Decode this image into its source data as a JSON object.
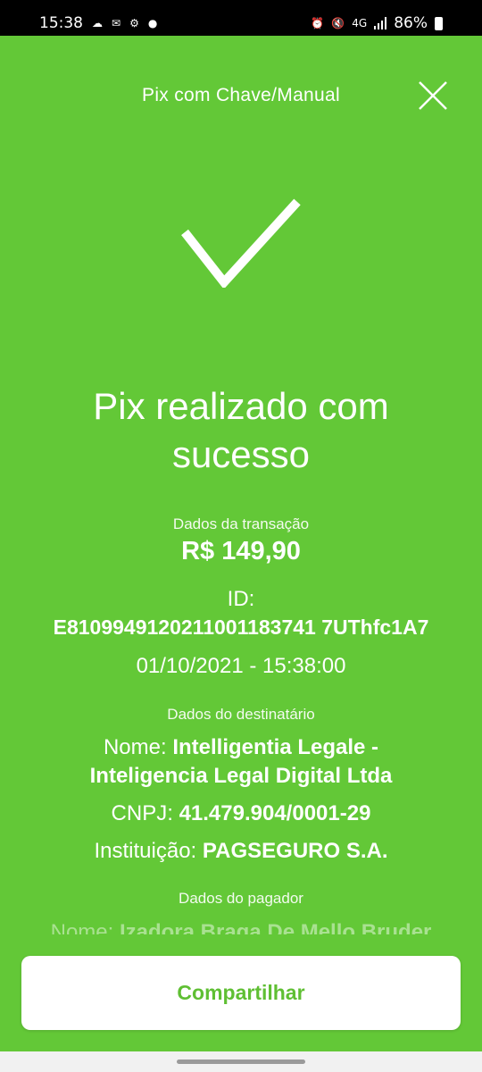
{
  "status_bar": {
    "time": "15:38",
    "network": "4G",
    "battery": "86%"
  },
  "header": {
    "title": "Pix com Chave/Manual"
  },
  "result": {
    "title_line1": "Pix realizado com",
    "title_line2": "sucesso"
  },
  "transaction": {
    "label": "Dados da transação",
    "amount": "R$ 149,90",
    "id_label": "ID:",
    "id_value": "E8109949120211001183741 7UThfc1A7",
    "datetime": "01/10/2021 - 15:38:00"
  },
  "recipient": {
    "label": "Dados do destinatário",
    "name_key": "Nome:",
    "name_value_line1": "Intelligentia Legale -",
    "name_value_line2": "Inteligencia Legal Digital Ltda",
    "cnpj_key": "CNPJ:",
    "cnpj_value": "41.479.904/0001-29",
    "institution_key": "Instituição:",
    "institution_value": "PAGSEGURO S.A."
  },
  "payer": {
    "label": "Dados do pagador",
    "name_key": "Nome:",
    "name_value": "Izadora Braga De Mello Bruder"
  },
  "actions": {
    "share_label": "Compartilhar"
  },
  "colors": {
    "background": "#63c837",
    "button_text": "#5fbf33"
  }
}
